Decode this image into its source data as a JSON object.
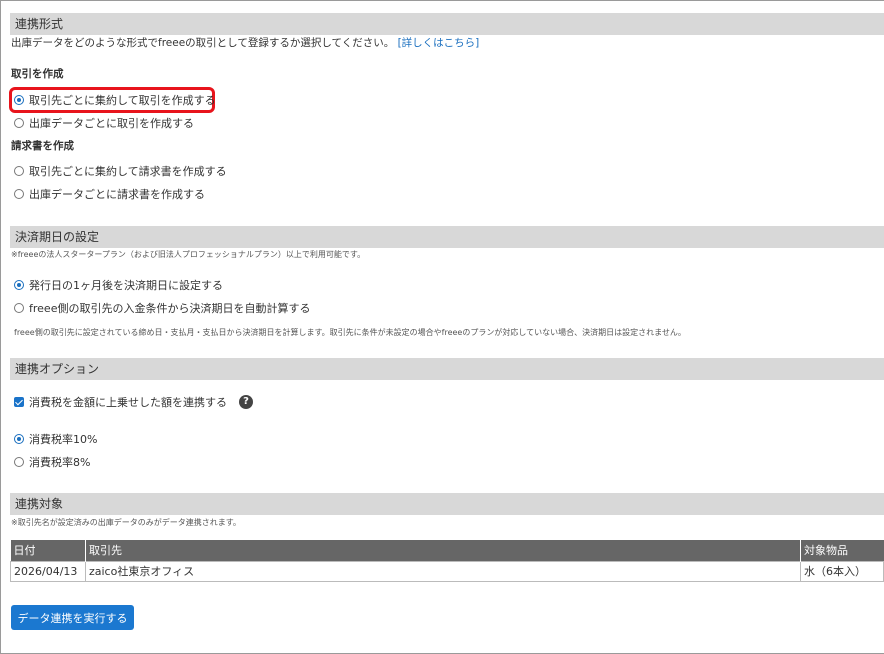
{
  "section_link_type": {
    "title": "連携形式",
    "desc": "出庫データをどのような形式でfreeeの取引として登録するか選択してください。",
    "help_link": "[詳しくはこちら]",
    "deal_title": "取引を作成",
    "deal_options": [
      {
        "label": "取引先ごとに集約して取引を作成する",
        "selected": true
      },
      {
        "label": "出庫データごとに取引を作成する",
        "selected": false
      }
    ],
    "invoice_title": "請求書を作成",
    "invoice_options": [
      {
        "label": "取引先ごとに集約して請求書を作成する",
        "selected": false
      },
      {
        "label": "出庫データごとに請求書を作成する",
        "selected": false
      }
    ]
  },
  "section_due_date": {
    "title": "決済期日の設定",
    "note": "※freeeの法人スタータープラン（および旧法人プロフェッショナルプラン）以上で利用可能です。",
    "options": [
      {
        "label": "発行日の1ヶ月後を決済期日に設定する",
        "selected": true
      },
      {
        "label": "freee側の取引先の入金条件から決済期日を自動計算する",
        "selected": false
      }
    ],
    "detail": "freee側の取引先に設定されている締め日・支払月・支払日から決済期日を計算します。取引先に条件が未設定の場合やfreeeのプランが対応していない場合、決済期日は設定されません。"
  },
  "section_options": {
    "title": "連携オプション",
    "tax_checkbox": {
      "label": "消費税を金額に上乗せした額を連携する",
      "checked": true
    },
    "help_icon": "?",
    "tax_rates": [
      {
        "label": "消費税率10%",
        "selected": true
      },
      {
        "label": "消費税率8%",
        "selected": false
      }
    ]
  },
  "section_target": {
    "title": "連携対象",
    "note": "※取引先名が設定済みの出庫データのみがデータ連携されます。",
    "columns": [
      "日付",
      "取引先",
      "対象物品"
    ],
    "rows": [
      {
        "date": "2026/04/13",
        "partner": "zaico社東京オフィス",
        "item": "水（6本入）"
      }
    ]
  },
  "execute_button": "データ連携を実行する",
  "colors": {
    "accent": "#1b78d0",
    "highlight": "#e8141c",
    "header_bg": "#d8d8d8",
    "table_header": "#666666"
  }
}
